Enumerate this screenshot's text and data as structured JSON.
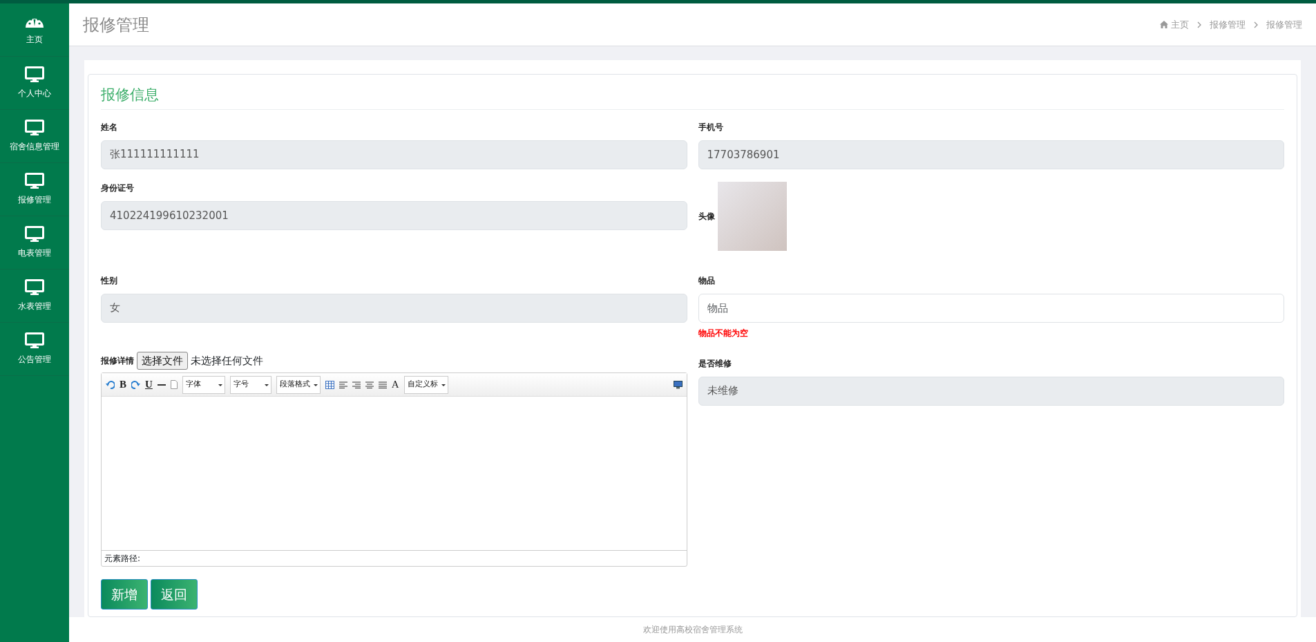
{
  "sidebar": {
    "items": [
      {
        "label": "主页",
        "kind": "gauge"
      },
      {
        "label": "个人中心",
        "kind": "monitor"
      },
      {
        "label": "宿舍信息管理",
        "kind": "monitor"
      },
      {
        "label": "报修管理",
        "kind": "monitor"
      },
      {
        "label": "电表管理",
        "kind": "monitor"
      },
      {
        "label": "水表管理",
        "kind": "monitor"
      },
      {
        "label": "公告管理",
        "kind": "monitor"
      }
    ]
  },
  "header": {
    "title": "报修管理",
    "breadcrumb": [
      "主页",
      "报修管理",
      "报修管理"
    ]
  },
  "form": {
    "title": "报修信息",
    "fields": [
      {
        "kind": "text",
        "label": "姓名",
        "value": "张111111111111",
        "disabled": true
      },
      {
        "kind": "text",
        "label": "手机号",
        "value": "17703786901",
        "disabled": true
      },
      {
        "kind": "text",
        "label": "身份证号",
        "value": "410224199610232001",
        "disabled": true
      },
      {
        "kind": "image",
        "label": "头像"
      },
      {
        "kind": "text",
        "label": "性别",
        "value": "女",
        "disabled": true
      },
      {
        "kind": "text",
        "label": "物品",
        "placeholder": "物品",
        "disabled": false,
        "error": "物品不能为空"
      },
      {
        "kind": "editor",
        "label": "报修详情",
        "file_button": "选择文件",
        "file_status": "未选择任何文件",
        "status": "元素路径:",
        "toolbar": [
          {
            "kind": "undo"
          },
          {
            "kind": "glyph",
            "text": "B"
          },
          {
            "kind": "redo"
          },
          {
            "kind": "underline",
            "text": "U"
          },
          {
            "kind": "rule"
          },
          {
            "kind": "page"
          },
          {
            "kind": "select",
            "text": "字体"
          },
          {
            "kind": "select",
            "text": "字号"
          },
          {
            "kind": "select",
            "text": "段落格式"
          },
          {
            "kind": "table"
          },
          {
            "kind": "align-left"
          },
          {
            "kind": "align-right"
          },
          {
            "kind": "align-center"
          },
          {
            "kind": "justify"
          },
          {
            "kind": "dropglyph",
            "text": "A"
          },
          {
            "kind": "select",
            "text": "自定义标"
          },
          {
            "kind": "preview"
          }
        ]
      },
      {
        "kind": "select",
        "label": "是否维修",
        "value": "未维修",
        "disabled": true
      }
    ],
    "buttons": [
      "新增",
      "返回"
    ]
  },
  "footer": {
    "text": "欢迎使用高校宿舍管理系统"
  }
}
